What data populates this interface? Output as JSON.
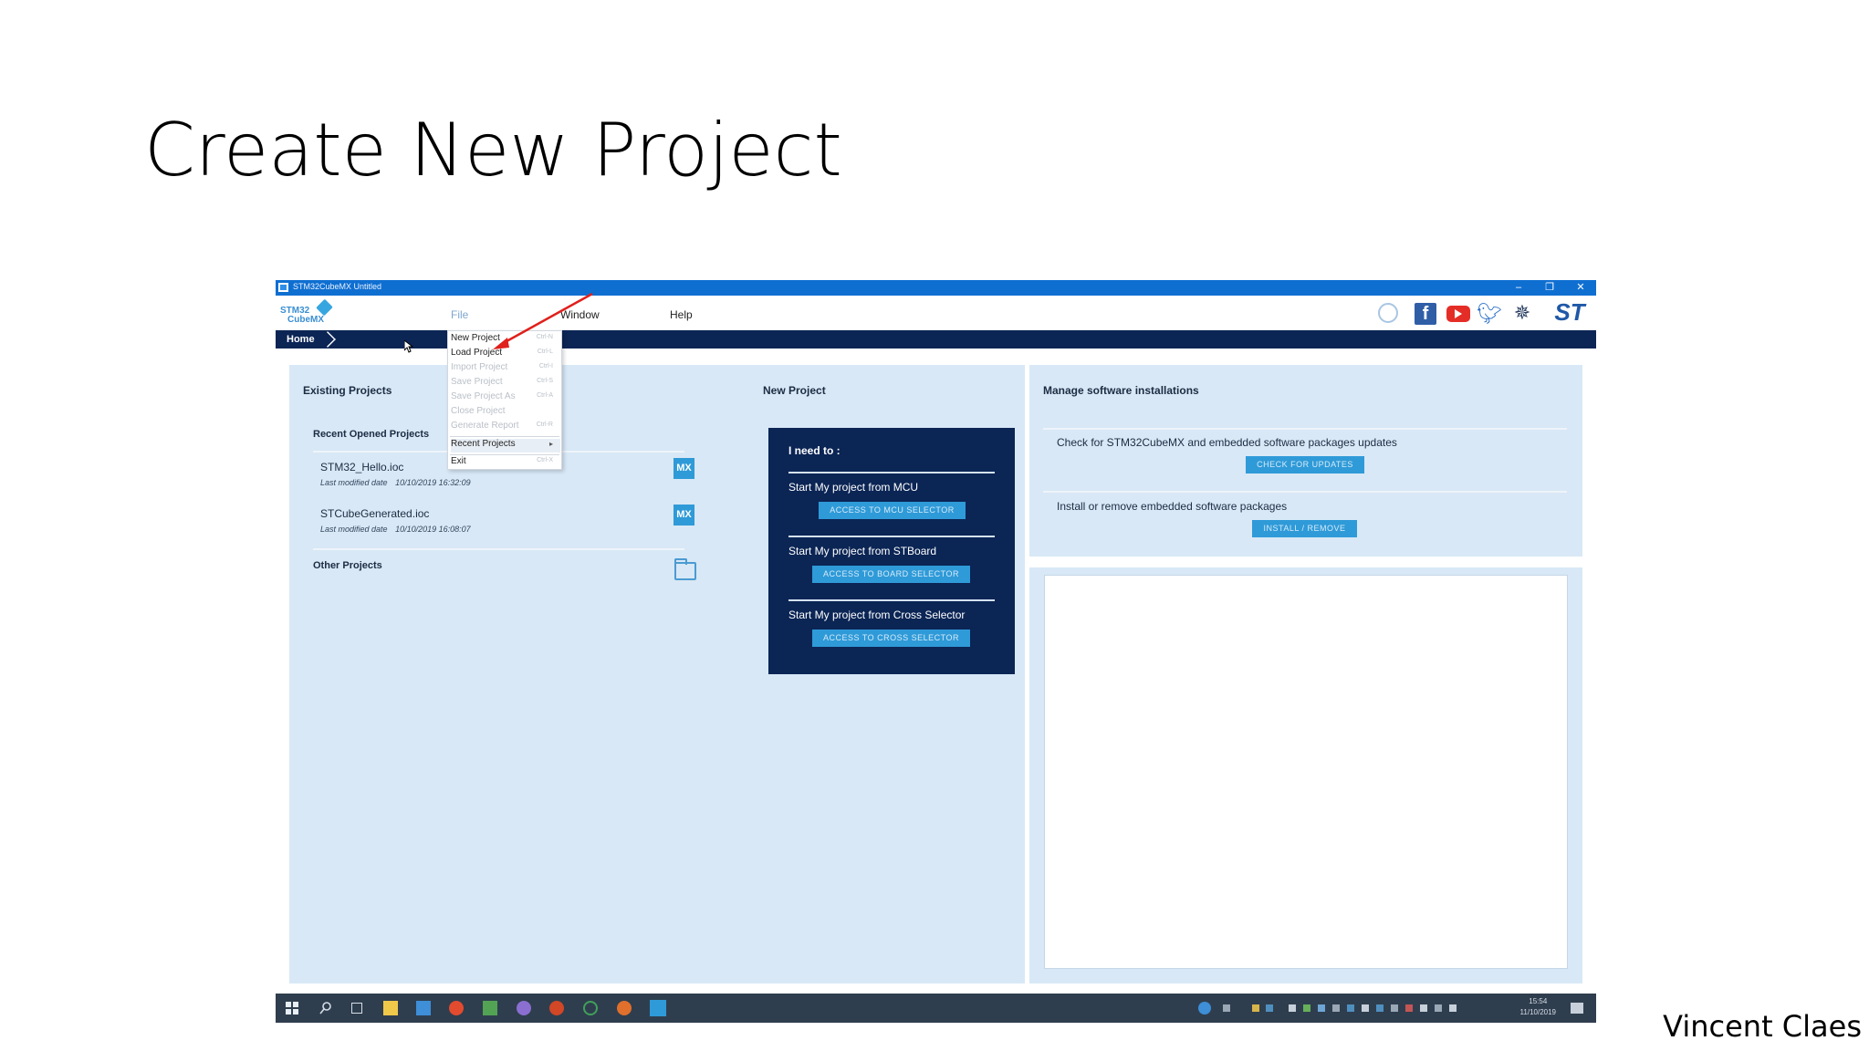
{
  "slide": {
    "title": "Create New Project",
    "author": "Vincent Claes"
  },
  "window": {
    "title": "STM32CubeMX Untitled",
    "minimize": "–",
    "restore": "❐",
    "close": "✕"
  },
  "logo": {
    "line1": "STM32",
    "line2": "CubeMX"
  },
  "menu": {
    "file": "File",
    "window": "Window",
    "help": "Help"
  },
  "breadcrumb": {
    "home": "Home"
  },
  "file_menu": {
    "items": [
      {
        "label": "New Project",
        "shortcut": "Ctrl-N",
        "enabled": true
      },
      {
        "label": "Load Project",
        "shortcut": "Ctrl-L",
        "enabled": true
      },
      {
        "label": "Import Project",
        "shortcut": "Ctrl-I",
        "enabled": false
      },
      {
        "label": "Save Project",
        "shortcut": "Ctrl-S",
        "enabled": false
      },
      {
        "label": "Save Project As",
        "shortcut": "Ctrl-A",
        "enabled": false
      },
      {
        "label": "Close Project",
        "shortcut": "",
        "enabled": false
      },
      {
        "label": "Generate Report",
        "shortcut": "Ctrl-R",
        "enabled": false
      }
    ],
    "recent": "Recent Projects",
    "exit": "Exit",
    "exit_shortcut": "Ctrl-X"
  },
  "existing": {
    "title": "Existing Projects",
    "recent_title": "Recent Opened Projects",
    "projects": [
      {
        "name": "STM32_Hello.ioc",
        "date_label": "Last modified date",
        "date": "10/10/2019 16:32:09",
        "badge": "MX"
      },
      {
        "name": "STCubeGenerated.ioc",
        "date_label": "Last modified date",
        "date": "10/10/2019 16:08:07",
        "badge": "MX"
      }
    ],
    "other_title": "Other Projects"
  },
  "new_project": {
    "title": "New Project",
    "need": "I need to :",
    "options": [
      {
        "text": "Start My project from MCU",
        "button": "ACCESS TO MCU SELECTOR"
      },
      {
        "text": "Start My project from STBoard",
        "button": "ACCESS TO BOARD SELECTOR"
      },
      {
        "text": "Start My project from Cross Selector",
        "button": "ACCESS TO CROSS SELECTOR"
      }
    ]
  },
  "manage": {
    "title": "Manage software installations",
    "check_text": "Check for STM32CubeMX and embedded software packages updates",
    "check_button": "CHECK FOR UPDATES",
    "install_text": "Install or remove embedded software packages",
    "install_button": "INSTALL / REMOVE"
  },
  "taskbar": {
    "time": "15:54",
    "date": "11/10/2019"
  },
  "colors": {
    "titlebar": "#0f6fd1",
    "navy": "#0b2555",
    "panel": "#d8e8f6",
    "accent": "#2f9ad8",
    "arrow": "#e0201b"
  },
  "icons": [
    "globe-icon",
    "facebook-icon",
    "youtube-icon",
    "twitter-icon",
    "network-icon",
    "st-logo-icon",
    "windows-start-icon",
    "search-icon",
    "folder-icon"
  ]
}
